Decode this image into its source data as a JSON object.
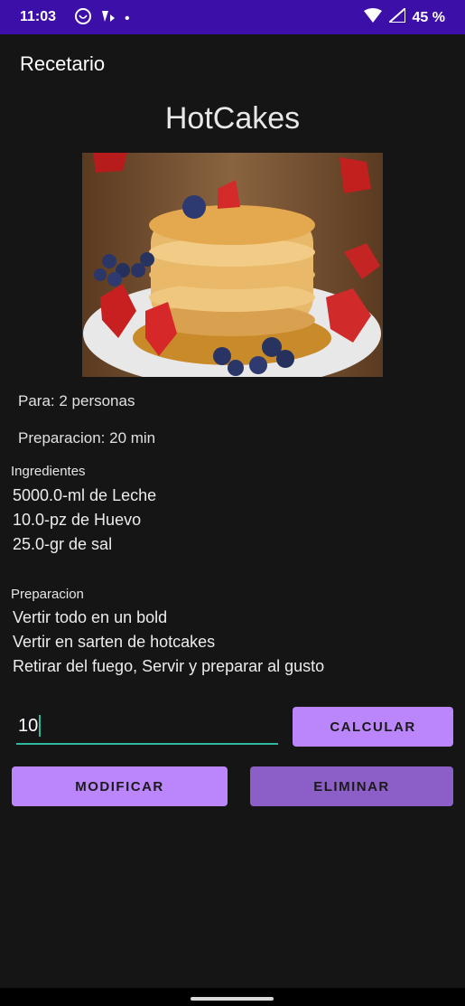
{
  "status_bar": {
    "time": "11:03",
    "dot": "•",
    "battery": "45 %",
    "icons": [
      "whatsapp-icon",
      "notification-icon",
      "wifi-icon",
      "signal-icon"
    ]
  },
  "app_bar": {
    "title": "Recetario"
  },
  "recipe": {
    "name": "HotCakes",
    "image_alt": "pancake-stack-photo",
    "servings": "Para: 2 personas",
    "prep_time": "Preparacion: 20 min",
    "ingredients_heading": "Ingredientes",
    "ingredients": [
      "5000.0-ml de Leche",
      "10.0-pz de Huevo",
      "25.0-gr de sal"
    ],
    "steps_heading": "Preparacion",
    "steps": [
      "Vertir todo en un bold",
      "Vertir en sarten de hotcakes",
      "Retirar del fuego, Servir y preparar al gusto"
    ]
  },
  "calculator": {
    "quantity_value": "10",
    "calculate_label": "CALCULAR"
  },
  "actions": {
    "modify_label": "MODIFICAR",
    "delete_label": "ELIMINAR"
  },
  "colors": {
    "status_bar": "#3c0fa8",
    "primary": "#bb86fc",
    "primary_dark": "#8c5fc8",
    "accent": "#2fb7a0",
    "background": "#151515"
  }
}
